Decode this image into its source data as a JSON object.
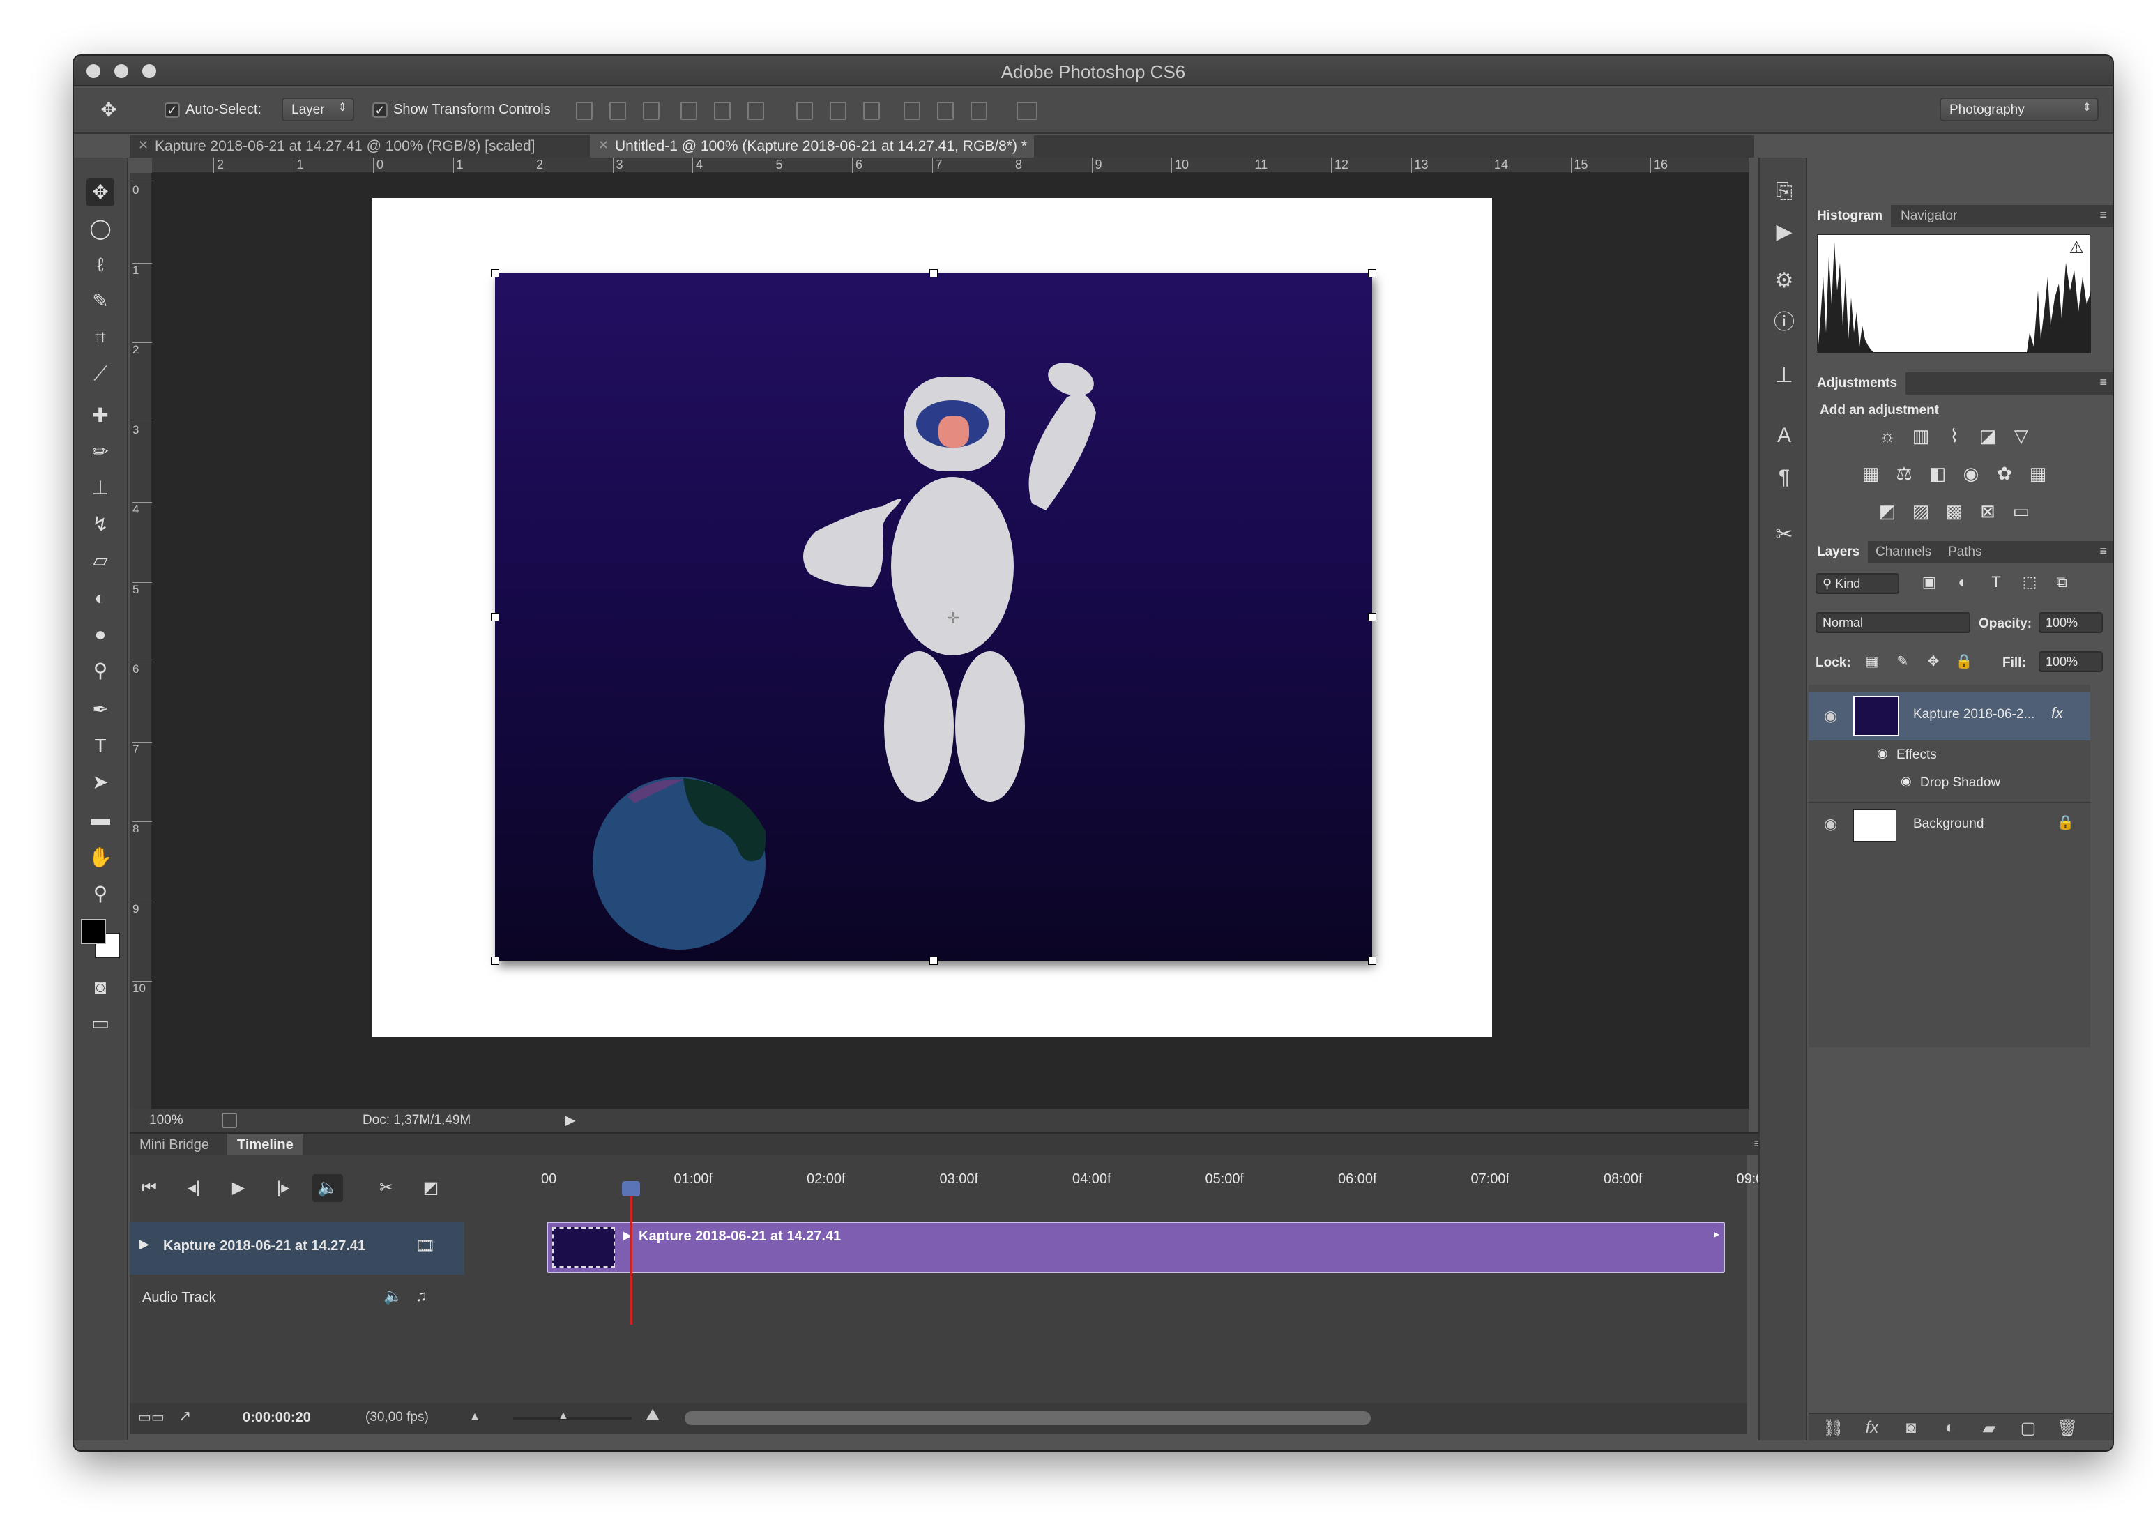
{
  "app": {
    "title": "Adobe Photoshop CS6"
  },
  "options_bar": {
    "auto_select_label": "Auto-Select:",
    "auto_select_value": "Layer",
    "show_transform_label": "Show Transform Controls",
    "workspace": "Photography"
  },
  "tabs": [
    {
      "label": "Kapture 2018-06-21 at 14.27.41 @ 100% (RGB/8) [scaled]"
    },
    {
      "label": "Untitled-1 @ 100% (Kapture 2018-06-21 at 14.27.41, RGB/8*) *"
    }
  ],
  "ruler_h": [
    "2",
    "1",
    "0",
    "1",
    "2",
    "3",
    "4",
    "5",
    "6",
    "7",
    "8",
    "9",
    "10",
    "11",
    "12",
    "13",
    "14",
    "15",
    "16"
  ],
  "ruler_v": [
    "0",
    "1",
    "2",
    "3",
    "4",
    "5",
    "6",
    "7",
    "8",
    "9",
    "1​0"
  ],
  "status": {
    "zoom": "100%",
    "doc": "Doc: 1,37M/1,49M"
  },
  "timeline": {
    "tab_mini_bridge": "Mini Bridge",
    "tab_timeline": "Timeline",
    "time_labels": [
      "00",
      "01:00f",
      "02:00f",
      "03:00f",
      "04:00f",
      "05:00f",
      "06:00f",
      "07:00f",
      "08:00f",
      "09:0"
    ],
    "track_name": "Kapture 2018-06-21 at 14.27.41",
    "clip_name": "Kapture 2018-06-21 at 14.27.41",
    "audio_track": "Audio Track",
    "current_time": "0:00:00:20",
    "fps": "(30,00 fps)"
  },
  "panels": {
    "histogram_tab": "Histogram",
    "navigator_tab": "Navigator",
    "adjustments_tab": "Adjustments",
    "add_adjustment": "Add an adjustment",
    "layers_tab": "Layers",
    "channels_tab": "Channels",
    "paths_tab": "Paths",
    "kind": "Kind",
    "blend_mode": "Normal",
    "opacity_label": "Opacity:",
    "opacity_value": "100%",
    "lock_label": "Lock:",
    "fill_label": "Fill:",
    "fill_value": "100%",
    "layers": [
      {
        "name": "Kapture 2018-06-2...",
        "fx": "fx"
      },
      {
        "name": "Effects"
      },
      {
        "name": "Drop Shadow"
      },
      {
        "name": "Background"
      }
    ]
  },
  "colors": {
    "art_top": "#230f61",
    "art_bottom": "#0b0524",
    "clip": "#7e5eb0",
    "playhead": "#d02020"
  }
}
